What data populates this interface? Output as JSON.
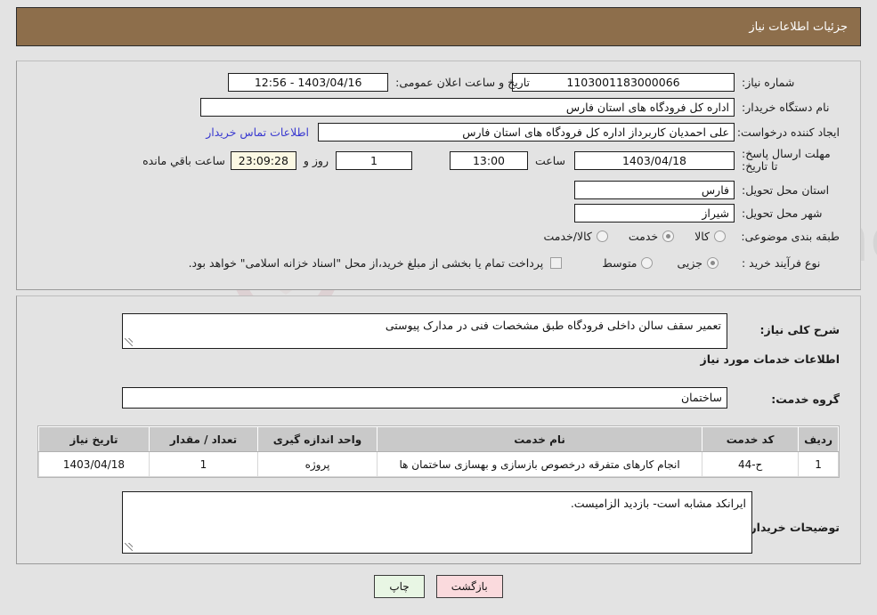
{
  "header": {
    "title": "جزئیات اطلاعات نیاز"
  },
  "watermark": {
    "text": "AriaTender.net"
  },
  "form": {
    "need_number_label": "شماره نیاز:",
    "need_number_value": "1103001183000066",
    "announce_label": "تاریخ و ساعت اعلان عمومی:",
    "announce_value": "1403/04/16 - 12:56",
    "buyer_org_label": "نام دستگاه خریدار:",
    "buyer_org_value": "اداره کل فرودگاه های استان فارس",
    "creator_label": "ایجاد کننده درخواست:",
    "creator_value": "علی  احمدیان کاربرداز اداره کل فرودگاه های استان فارس",
    "buyer_contact_link": "اطلاعات تماس خریدار",
    "deadline_label": "مهلت ارسال پاسخ: تا تاریخ:",
    "deadline_date": "1403/04/18",
    "deadline_hour_label": "ساعت",
    "deadline_hour": "13:00",
    "days_value": "1",
    "days_label": "روز و",
    "countdown_value": "23:09:28",
    "countdown_label": "ساعت باقي مانده",
    "province_label": "استان محل تحویل:",
    "province_value": "فارس",
    "city_label": "شهر محل تحویل:",
    "city_value": "شیراز",
    "category_label": "طبقه بندی موضوعی:",
    "category_options": [
      {
        "label": "کالا",
        "selected": false
      },
      {
        "label": "خدمت",
        "selected": true
      },
      {
        "label": "کالا/خدمت",
        "selected": false
      }
    ],
    "process_label": "نوع فرآیند خرید :",
    "process_options": [
      {
        "label": "جزیی",
        "selected": true
      },
      {
        "label": "متوسط",
        "selected": false
      }
    ],
    "treasury_checkbox_checked": false,
    "treasury_note": "پرداخت تمام یا بخشی از مبلغ خرید،از محل \"اسناد خزانه اسلامی\" خواهد بود."
  },
  "description": {
    "label": "شرح کلی نیاز:",
    "value": "تعمیر سقف سالن داخلی فرودگاه طبق مشخصات فنی در مدارک پیوستی"
  },
  "services": {
    "section_title": "اطلاعات خدمات مورد نیاز",
    "group_label": "گروه خدمت:",
    "group_value": "ساختمان",
    "columns": [
      "ردیف",
      "کد خدمت",
      "نام خدمت",
      "واحد اندازه گیری",
      "تعداد / مقدار",
      "تاریخ نیاز"
    ],
    "rows": [
      {
        "row": "1",
        "code": "ح-44",
        "name": "انجام کارهای متفرقه درخصوص بازسازی و بهسازی ساختمان ها",
        "unit": "پروژه",
        "quantity": "1",
        "date": "1403/04/18"
      }
    ]
  },
  "buyer_notes": {
    "label": "توضیحات خریدار:",
    "value": "ایرانکد مشابه است- بازدید الزامیست."
  },
  "buttons": {
    "back": "بازگشت",
    "print": "چاپ"
  },
  "colors": {
    "header_bg": "#8d6e4b",
    "page_bg": "#e3e3e3",
    "link": "#3a3ad0",
    "back_btn": "#fadadd",
    "print_btn": "#e8f6e4",
    "countdown_bg": "#fbf8e3",
    "table_header_bg": "#c9c9c9"
  }
}
